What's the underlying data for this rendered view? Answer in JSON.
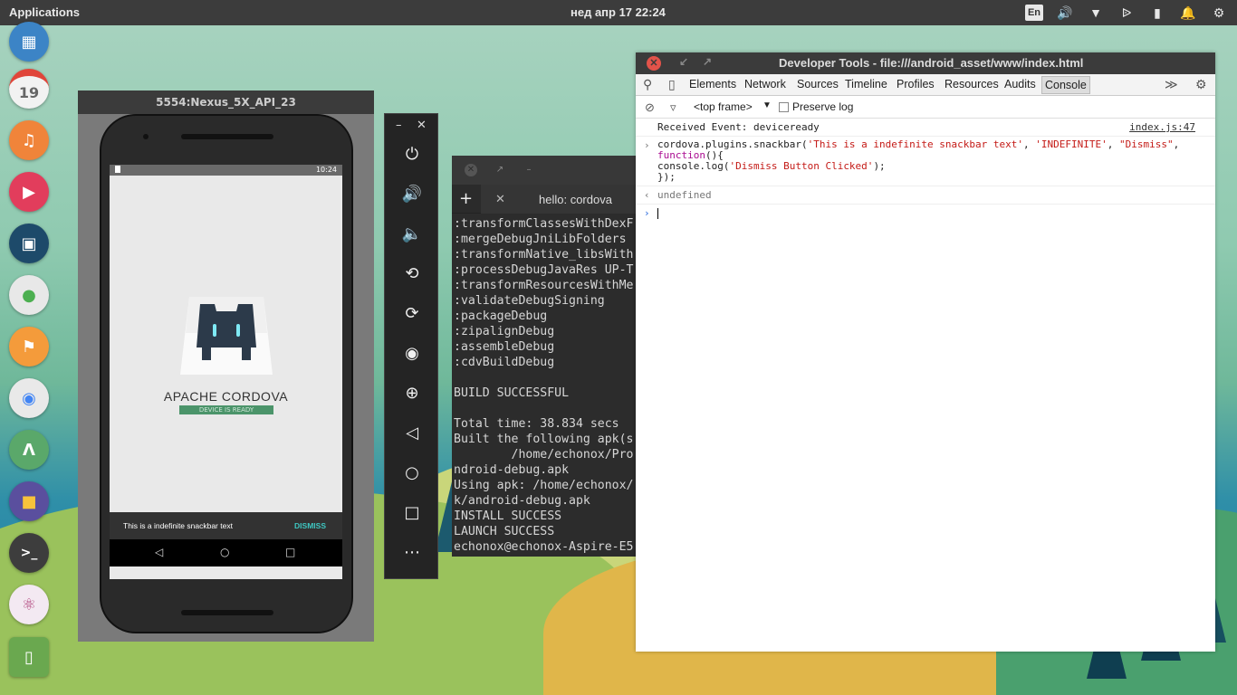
{
  "topbar": {
    "applications": "Applications",
    "datetime": "нед апр 17   22:24",
    "lang": "En"
  },
  "dock": {
    "calendar_day": "19",
    "terminal_glyph": ">_",
    "items": [
      "files-icon",
      "calendar-icon",
      "music-icon",
      "video-icon",
      "image-icon",
      "settings-icon",
      "store-icon",
      "chrome-icon",
      "android-studio-icon",
      "folder-icon",
      "terminal-icon",
      "atom-icon",
      "device-icon"
    ]
  },
  "emulator": {
    "title": "5554:Nexus_5X_API_23",
    "status_time": "10:24",
    "app_title": "APACHE CORDOVA",
    "device_ready": "DEVICE IS READY",
    "snackbar_text": "This is a indefinite snackbar text",
    "snackbar_action": "DISMISS"
  },
  "terminal": {
    "tab_title": "hello: cordova",
    "lines": [
      ":transformClassesWithDexF",
      ":mergeDebugJniLibFolders",
      ":transformNative_libsWith",
      ":processDebugJavaRes UP-T",
      ":transformResourcesWithMe",
      ":validateDebugSigning",
      ":packageDebug",
      ":zipalignDebug",
      ":assembleDebug",
      ":cdvBuildDebug",
      "",
      "BUILD SUCCESSFUL",
      "",
      "Total time: 38.834 secs",
      "Built the following apk(s",
      "        /home/echonox/Pro",
      "ndroid-debug.apk",
      "Using apk: /home/echonox/",
      "k/android-debug.apk",
      "INSTALL SUCCESS",
      "LAUNCH SUCCESS",
      "echonox@echonox-Aspire-E5"
    ]
  },
  "devtools": {
    "title": "Developer Tools - file:///android_asset/www/index.html",
    "tabs": [
      "Elements",
      "Network",
      "Sources",
      "Timeline",
      "Profiles",
      "Resources",
      "Audits",
      "Console"
    ],
    "active_tab": "Console",
    "frame": "<top frame>",
    "preserve_log": "Preserve log",
    "log_message": "Received Event: deviceready",
    "log_source": "index.js:47",
    "cmd_line1_a": "cordova.plugins.snackbar(",
    "cmd_line1_s1": "'This is a indefinite snackbar text'",
    "cmd_line1_c1": ", ",
    "cmd_line1_s2": "'INDEFINITE'",
    "cmd_line1_c2": ", ",
    "cmd_line1_s3": "\"Dismiss\"",
    "cmd_line1_c3": ",",
    "cmd_line2": "function",
    "cmd_line2_b": "(){",
    "cmd_line3_a": "console.log(",
    "cmd_line3_s": "'Dismiss Button Clicked'",
    "cmd_line3_b": ");",
    "cmd_line4": "});",
    "result": "undefined"
  }
}
